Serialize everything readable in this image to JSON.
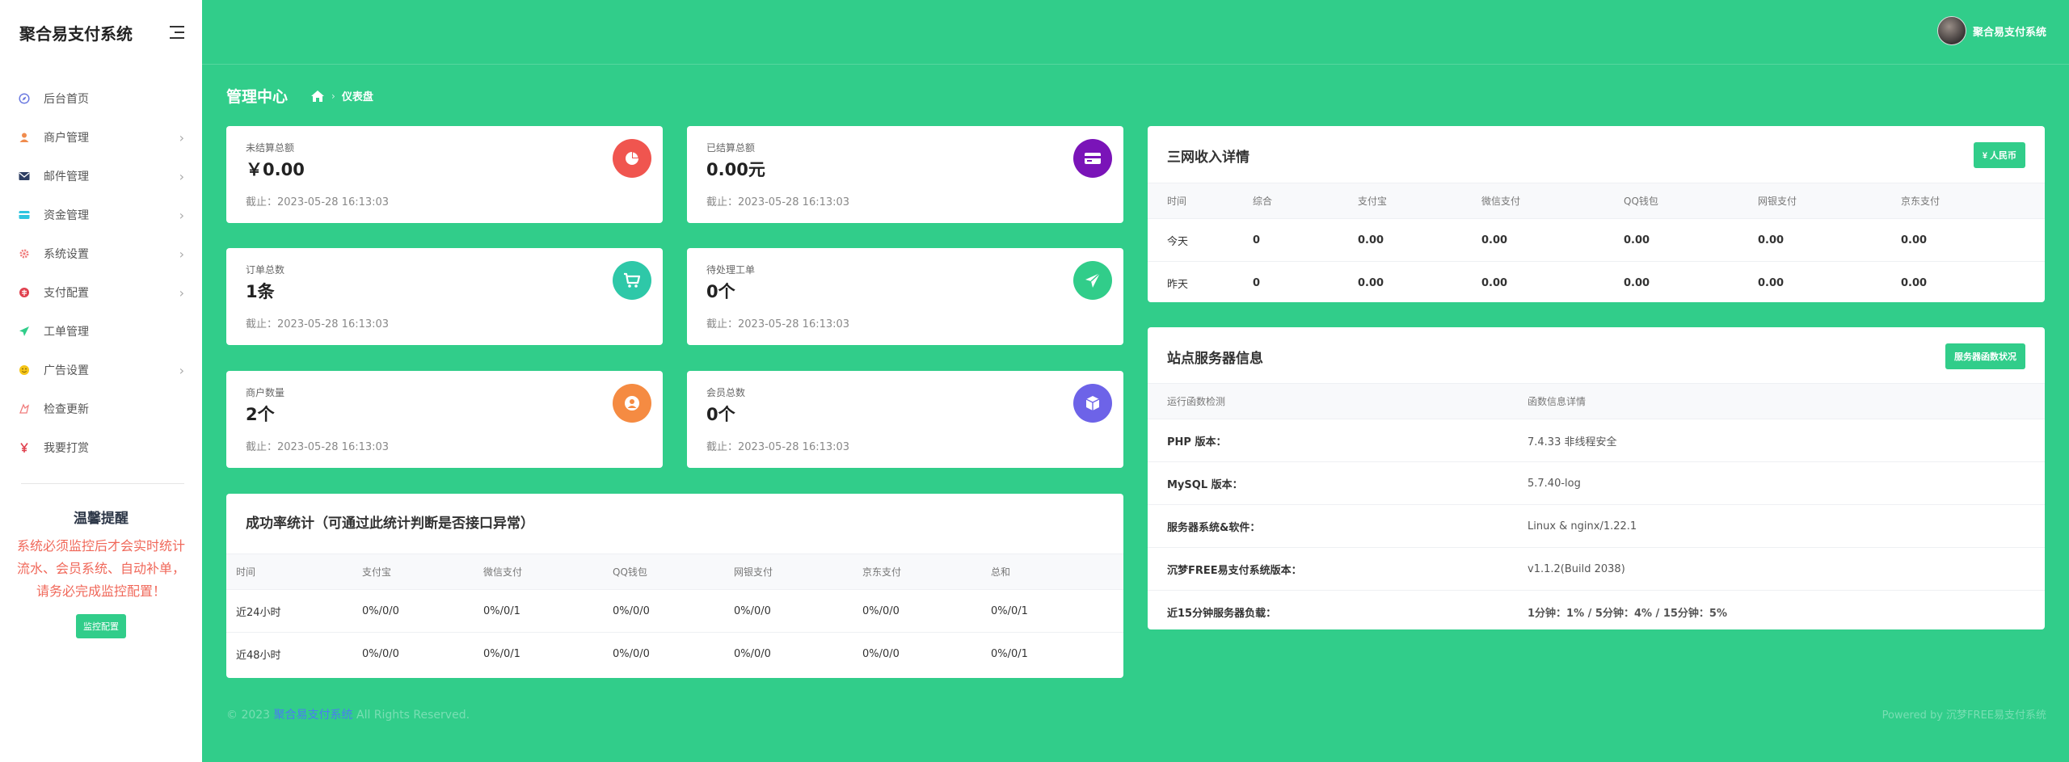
{
  "sidebar": {
    "brand": "聚合易支付系统",
    "items": [
      {
        "label": "后台首页",
        "icon": "compass-icon",
        "color": "#6c7ae0",
        "chev": false
      },
      {
        "label": "商户管理",
        "icon": "user-icon",
        "color": "#f08c4e",
        "chev": true
      },
      {
        "label": "邮件管理",
        "icon": "mail-icon",
        "color": "#2d3e63",
        "chev": true
      },
      {
        "label": "资金管理",
        "icon": "wallet-icon",
        "color": "#2ec5e0",
        "chev": true
      },
      {
        "label": "系统设置",
        "icon": "gear-icon",
        "color": "#f07c7c",
        "chev": true
      },
      {
        "label": "支付配置",
        "icon": "pay-icon",
        "color": "#e0404e",
        "chev": true
      },
      {
        "label": "工单管理",
        "icon": "send-icon",
        "color": "#31cd8a",
        "chev": false
      },
      {
        "label": "广告设置",
        "icon": "smile-icon",
        "color": "#f5c518",
        "chev": true
      },
      {
        "label": "检查更新",
        "icon": "update-icon",
        "color": "#f07c7c",
        "chev": false
      },
      {
        "label": "我要打赏",
        "icon": "yen-icon",
        "color": "#e0404e",
        "chev": false
      }
    ],
    "tips": {
      "title": "温馨提醒",
      "text": "系统必须监控后才会实时统计流水、会员系统、自动补单，请务必完成监控配置！",
      "button": "监控配置"
    }
  },
  "topbar": {
    "username": "聚合易支付系统"
  },
  "header": {
    "title": "管理中心",
    "breadcrumb": "仪表盘"
  },
  "stats": [
    {
      "label": "未结算总额",
      "value": "￥0.00",
      "sub": "截止：2023-05-28 16:13:03",
      "icon": "pie-chart-icon",
      "color": "#f0554f"
    },
    {
      "label": "已结算总额",
      "value": "0.00元",
      "sub": "截止：2023-05-28 16:13:03",
      "icon": "credit-card-icon",
      "color": "#7a14b8"
    },
    {
      "label": "订单总数",
      "value": "1条",
      "sub": "截止：2023-05-28 16:13:03",
      "icon": "cart-icon",
      "color": "#2ec8a8"
    },
    {
      "label": "待处理工单",
      "value": "0个",
      "sub": "截止：2023-05-28 16:13:03",
      "icon": "paper-plane-icon",
      "color": "#31cd8a"
    },
    {
      "label": "商户数量",
      "value": "2个",
      "sub": "截止：2023-05-28 16:13:03",
      "icon": "user-circle-icon",
      "color": "#f58b42"
    },
    {
      "label": "会员总数",
      "value": "0个",
      "sub": "截止：2023-05-28 16:13:03",
      "icon": "cube-icon",
      "color": "#6d63e8"
    }
  ],
  "success": {
    "title": "成功率统计（可通过此统计判断是否接口异常）",
    "headers": [
      "时间",
      "支付宝",
      "微信支付",
      "QQ钱包",
      "网银支付",
      "京东支付",
      "总和"
    ],
    "rows": [
      [
        "近24小时",
        "0%/0/0",
        "0%/0/1",
        "0%/0/0",
        "0%/0/0",
        "0%/0/0",
        "0%/0/1"
      ],
      [
        "近48小时",
        "0%/0/0",
        "0%/0/1",
        "0%/0/0",
        "0%/0/0",
        "0%/0/0",
        "0%/0/1"
      ]
    ]
  },
  "income": {
    "title": "三网收入详情",
    "button": "¥ 人民币",
    "headers": [
      "时间",
      "综合",
      "支付宝",
      "微信支付",
      "QQ钱包",
      "网银支付",
      "京东支付"
    ],
    "rows": [
      [
        "今天",
        "0",
        "0.00",
        "0.00",
        "0.00",
        "0.00",
        "0.00"
      ],
      [
        "昨天",
        "0",
        "0.00",
        "0.00",
        "0.00",
        "0.00",
        "0.00"
      ]
    ]
  },
  "server": {
    "title": "站点服务器信息",
    "button": "服务器函数状况",
    "headers": [
      "运行函数检测",
      "函数信息详情"
    ],
    "rows": [
      [
        "PHP 版本：",
        "7.4.33 非线程安全"
      ],
      [
        "MySQL 版本：",
        "5.7.40-log"
      ],
      [
        "服务器系统&软件：",
        "Linux & nginx/1.22.1"
      ],
      [
        "沉梦FREE易支付系统版本：",
        "v1.1.2(Build 2038)"
      ],
      [
        "近15分钟服务器负载：",
        "1分钟：1% / 5分钟：4% / 15分钟：5%"
      ]
    ]
  },
  "footer": {
    "prefix": "© 2023",
    "link": "聚合易支付系统",
    "suffix": "All Rights Reserved.",
    "right": "Powered by 沉梦FREE易支付系统"
  },
  "colors": {
    "accent": "#31cd8a"
  }
}
